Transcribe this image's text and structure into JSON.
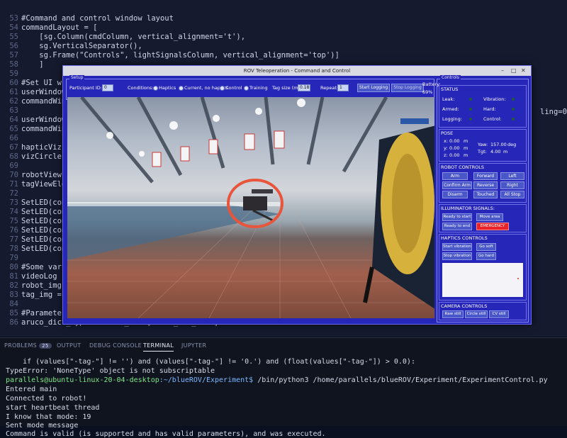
{
  "editor": {
    "lines": [
      {
        "num": "53",
        "text": "#Command and control window layout"
      },
      {
        "num": "54",
        "text": "commandLayout = ["
      },
      {
        "num": "55",
        "text": "    [sg.Column(cmdColumn, vertical_alignment='t'),"
      },
      {
        "num": "56",
        "text": "    sg.VerticalSeparator(),"
      },
      {
        "num": "57",
        "text": "    sg.Frame(\"Controls\", lightSignalsColumn, vertical_alignment='top')]"
      },
      {
        "num": "58",
        "text": "    ]"
      },
      {
        "num": "59",
        "text": ""
      },
      {
        "num": "60",
        "text": "#Set UI w"
      },
      {
        "num": "61",
        "text": "userWindow"
      },
      {
        "num": "62",
        "text": "commandWin"
      },
      {
        "num": "63",
        "text": ""
      },
      {
        "num": "64",
        "text": "userWindow"
      },
      {
        "num": "65",
        "text": "commandWin"
      },
      {
        "num": "66",
        "text": ""
      },
      {
        "num": "67",
        "text": "hapticViz"
      },
      {
        "num": "68",
        "text": "vizCircle"
      },
      {
        "num": "69",
        "text": ""
      },
      {
        "num": "70",
        "text": "robotView"
      },
      {
        "num": "71",
        "text": "tagViewEle"
      },
      {
        "num": "72",
        "text": ""
      },
      {
        "num": "73",
        "text": "SetLED(con"
      },
      {
        "num": "74",
        "text": "SetLED(con"
      },
      {
        "num": "75",
        "text": "SetLED(con"
      },
      {
        "num": "76",
        "text": "SetLED(con"
      },
      {
        "num": "77",
        "text": "SetLED(con"
      },
      {
        "num": "78",
        "text": "SetLED(con"
      },
      {
        "num": "79",
        "text": ""
      },
      {
        "num": "80",
        "text": "#Some var"
      },
      {
        "num": "81",
        "text": "videoLog ("
      },
      {
        "num": "82",
        "text": "robot_img"
      },
      {
        "num": "83",
        "text": "tag_img ="
      },
      {
        "num": "84",
        "text": ""
      },
      {
        "num": "85",
        "text": "#Parameters for ArUco localisation"
      },
      {
        "num": "86",
        "text": "aruco_dict_type = ARUCO_DICT['DICT_4X4_100']"
      }
    ],
    "right_fragment": "ling=0,"
  },
  "panel": {
    "tabs": [
      "PROBLEMS",
      "OUTPUT",
      "DEBUG CONSOLE",
      "TERMINAL",
      "JUPYTER"
    ],
    "problems_count": "25",
    "active_tab": "TERMINAL",
    "terminal": {
      "line1": "    if (values[\"-tag-\"] != '') and (values[\"-tag-\"] != '0.') and (float(values[\"-tag-\"]) > 0.0):",
      "line2": "TypeError: 'NoneType' object is not subscriptable",
      "prompt_user": "parallels@ubuntu-linux-20-04-desktop",
      "prompt_path": ":~/blueROV/Experiment$",
      "prompt_cmd": " /bin/python3 /home/parallels/blueROV/Experiment/ExperimentControl.py",
      "out1": "Entered main",
      "out2": "Connected to robot!",
      "out3": "start heartbeat thread",
      "out4": "I know that mode: 19",
      "out5": "Sent mode message",
      "out6": "Command is valid (is supported and has valid parameters), and was executed."
    }
  },
  "rov": {
    "title": "ROV Teleoperation - Command and Control",
    "setup": {
      "frame_label": "Setup",
      "participant_label": "Participant ID:",
      "participant_value": "0",
      "conditions_label": "Conditions:",
      "conditions": [
        "Haptics",
        "Current, no haptics",
        "Control",
        "Training"
      ],
      "tag_size_label": "Tag size (m):",
      "tag_size_value": "0.18",
      "repeat_label": "Repeat:",
      "repeat_value": "1",
      "start_logging": "Start Logging",
      "stop_logging": "Stop Logging",
      "battery_label": "Battery:",
      "battery_value": "69%"
    },
    "controls": {
      "frame_label": "Controls",
      "status": {
        "title": "STATUS",
        "leak": "Leak:",
        "vibration": "Vibration:",
        "armed": "Armed:",
        "hard": "Hard:",
        "logging": "Logging:",
        "control": "Control:"
      },
      "pose": {
        "title": "POSE",
        "x": "x:",
        "x_val": "0.00",
        "y": "y:",
        "y_val": "0.00",
        "z": "z:",
        "z_val": "0.00",
        "yaw": "Yaw:",
        "yaw_val": "157.00",
        "tgt": "Tgt:",
        "tgt_val": "4.00",
        "m": "m",
        "deg": "deg"
      },
      "robot_controls": {
        "title": "ROBOT CONTROLS",
        "buttons": [
          "Arm",
          "Forward",
          "Left",
          "Confirm Arm",
          "Reverse",
          "Right",
          "Disarm",
          "Touched",
          "All Stop"
        ]
      },
      "illuminator": {
        "title": "ILLUMINATOR SIGNALS:",
        "buttons": [
          "Ready to start",
          "Move area",
          "Ready to end",
          "EMERGENCY"
        ]
      },
      "haptics": {
        "title": "HAPTICS CONTROLS",
        "buttons": [
          "Start vibration",
          "Go soft",
          "Stop vibration",
          "Go hard"
        ]
      },
      "camera": {
        "title": "CAMERA CONTROLS",
        "buttons": [
          "Raw still",
          "Circle still",
          "CV still"
        ]
      }
    }
  }
}
